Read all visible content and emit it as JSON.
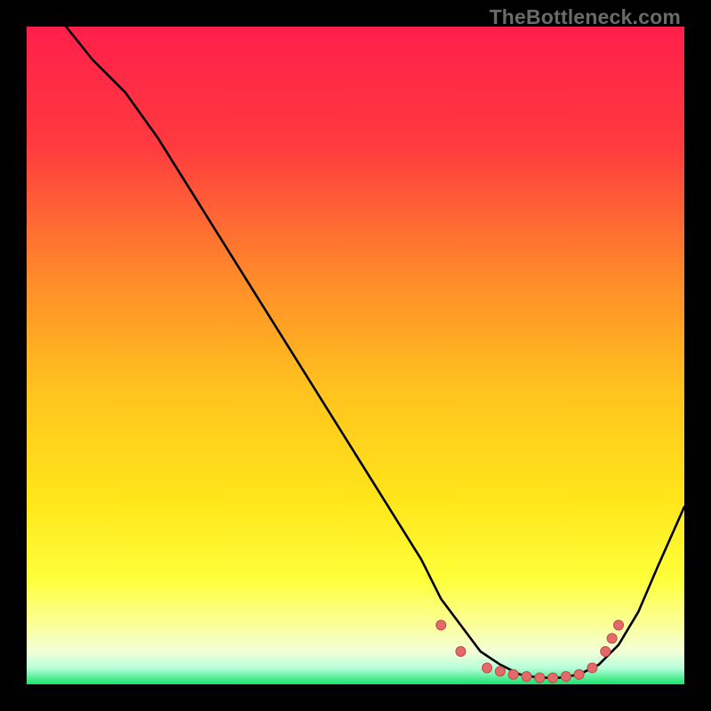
{
  "watermark": "TheBottleneck.com",
  "colors": {
    "bg_black": "#000000",
    "grad_top": "#ff1f4a",
    "grad_mid1": "#ff7a2a",
    "grad_mid2": "#ffd31a",
    "grad_low": "#ffff55",
    "grad_pale": "#fdffce",
    "grad_green": "#16e36b",
    "curve_stroke": "#000000",
    "dot_fill": "#e46a6a",
    "dot_stroke": "#c24a4a",
    "watermark_text": "#6a6a6a"
  },
  "chart_data": {
    "type": "line",
    "title": "",
    "xlabel": "",
    "ylabel": "",
    "xlim": [
      0,
      100
    ],
    "ylim": [
      0,
      100
    ],
    "note": "Axes have no visible tick labels; proportions below are estimated from pixel positions (0–100 normalized).",
    "series": [
      {
        "name": "bottleneck-curve",
        "x": [
          6,
          10,
          15,
          20,
          25,
          30,
          35,
          40,
          45,
          50,
          55,
          60,
          63,
          66,
          69,
          72,
          75,
          78,
          81,
          84,
          87,
          90,
          93,
          96,
          100
        ],
        "y": [
          100,
          95,
          90,
          83,
          75,
          67,
          59,
          51,
          43,
          35,
          27,
          19,
          13,
          9,
          5,
          3,
          1.5,
          1,
          1,
          1.5,
          3,
          6,
          11,
          18,
          27
        ]
      }
    ],
    "highlight_dots": {
      "name": "flat-minimum-dots",
      "x": [
        63,
        66,
        70,
        72,
        74,
        76,
        78,
        80,
        82,
        84,
        86,
        88,
        89,
        90
      ],
      "y": [
        9,
        5,
        2.5,
        2,
        1.5,
        1.2,
        1,
        1,
        1.2,
        1.5,
        2.5,
        5,
        7,
        9
      ]
    },
    "gradient_stops_pct_from_top": {
      "red": 0,
      "orange": 38,
      "yellow": 62,
      "bright_yellow": 80,
      "pale_yellow": 92,
      "green": 98
    }
  }
}
